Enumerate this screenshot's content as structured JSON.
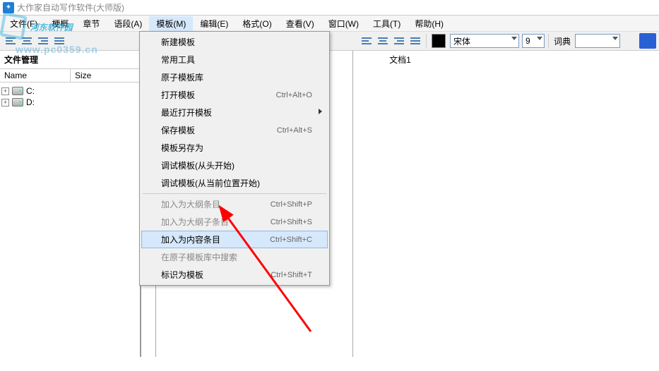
{
  "title": "大作家自动写作软件(大师版)",
  "menu": {
    "file": "文件(F)",
    "outline": "梗概",
    "chapter": "章节",
    "segment": "语段(A)",
    "template": "模板(M)",
    "edit": "编辑(E)",
    "format": "格式(O)",
    "view": "查看(V)",
    "window": "窗口(W)",
    "tool": "工具(T)",
    "help": "帮助(H)"
  },
  "dropdown": {
    "new_template": "新建模板",
    "common_tools": "常用工具",
    "atom_lib": "原子模板库",
    "open_template": "打开模板",
    "open_sc": "Ctrl+Alt+O",
    "recent_open": "最近打开模板",
    "save_template": "保存模板",
    "save_sc": "Ctrl+Alt+S",
    "save_as": "模板另存为",
    "debug_start": "调试模板(从头开始)",
    "debug_current": "调试模板(从当前位置开始)",
    "add_outline": "加入为大纲条目",
    "add_outline_sc": "Ctrl+Shift+P",
    "add_sub_outline": "加入为大纲子条目",
    "add_sub_outline_sc": "Ctrl+Shift+S",
    "add_content": "加入为内容条目",
    "add_content_sc": "Ctrl+Shift+C",
    "search_atom": "在原子模板库中搜索",
    "mark_template": "标识为模板",
    "mark_template_sc": "Ctrl+Shift+T"
  },
  "toolbar": {
    "font": "宋体",
    "size": "9",
    "dict_label": "词典"
  },
  "doc_title": "文档1",
  "file_panel": {
    "title": "文件管理",
    "col_name": "Name",
    "col_size": "Size",
    "drive_c": "C:",
    "drive_d": "D:"
  },
  "watermark": {
    "line1": "河东软件园",
    "line2": "www.pc0359.cn"
  }
}
